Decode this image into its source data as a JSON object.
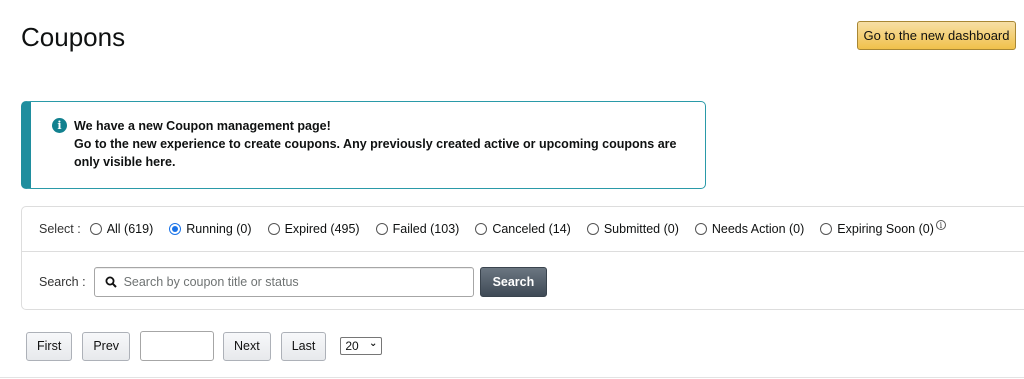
{
  "page": {
    "title": "Coupons"
  },
  "header": {
    "dashboard_button": "Go to the new dashboard"
  },
  "alert": {
    "icon": "info-icon",
    "line1": "We have a new Coupon management page!",
    "line2": "Go to the new experience to create coupons. Any previously created active or upcoming coupons are",
    "line3": "only visible here.",
    "accent_color": "#1f8e9e"
  },
  "filters": {
    "select_label": "Select :",
    "options": [
      {
        "label": "All (619)",
        "checked": false
      },
      {
        "label": "Running (0)",
        "checked": true
      },
      {
        "label": "Expired (495)",
        "checked": false
      },
      {
        "label": "Failed (103)",
        "checked": false
      },
      {
        "label": "Canceled (14)",
        "checked": false
      },
      {
        "label": "Submitted (0)",
        "checked": false
      },
      {
        "label": "Needs Action (0)",
        "checked": false
      },
      {
        "label": "Expiring Soon (0)",
        "checked": false
      }
    ],
    "expiring_info_icon": "info-icon"
  },
  "search": {
    "label": "Search :",
    "placeholder": "Search by coupon title or status",
    "value": "",
    "button": "Search",
    "icon": "magnifier-icon"
  },
  "pagination": {
    "first": "First",
    "prev": "Prev",
    "page_value": "",
    "next": "Next",
    "last": "Last",
    "per_page": "20"
  }
}
